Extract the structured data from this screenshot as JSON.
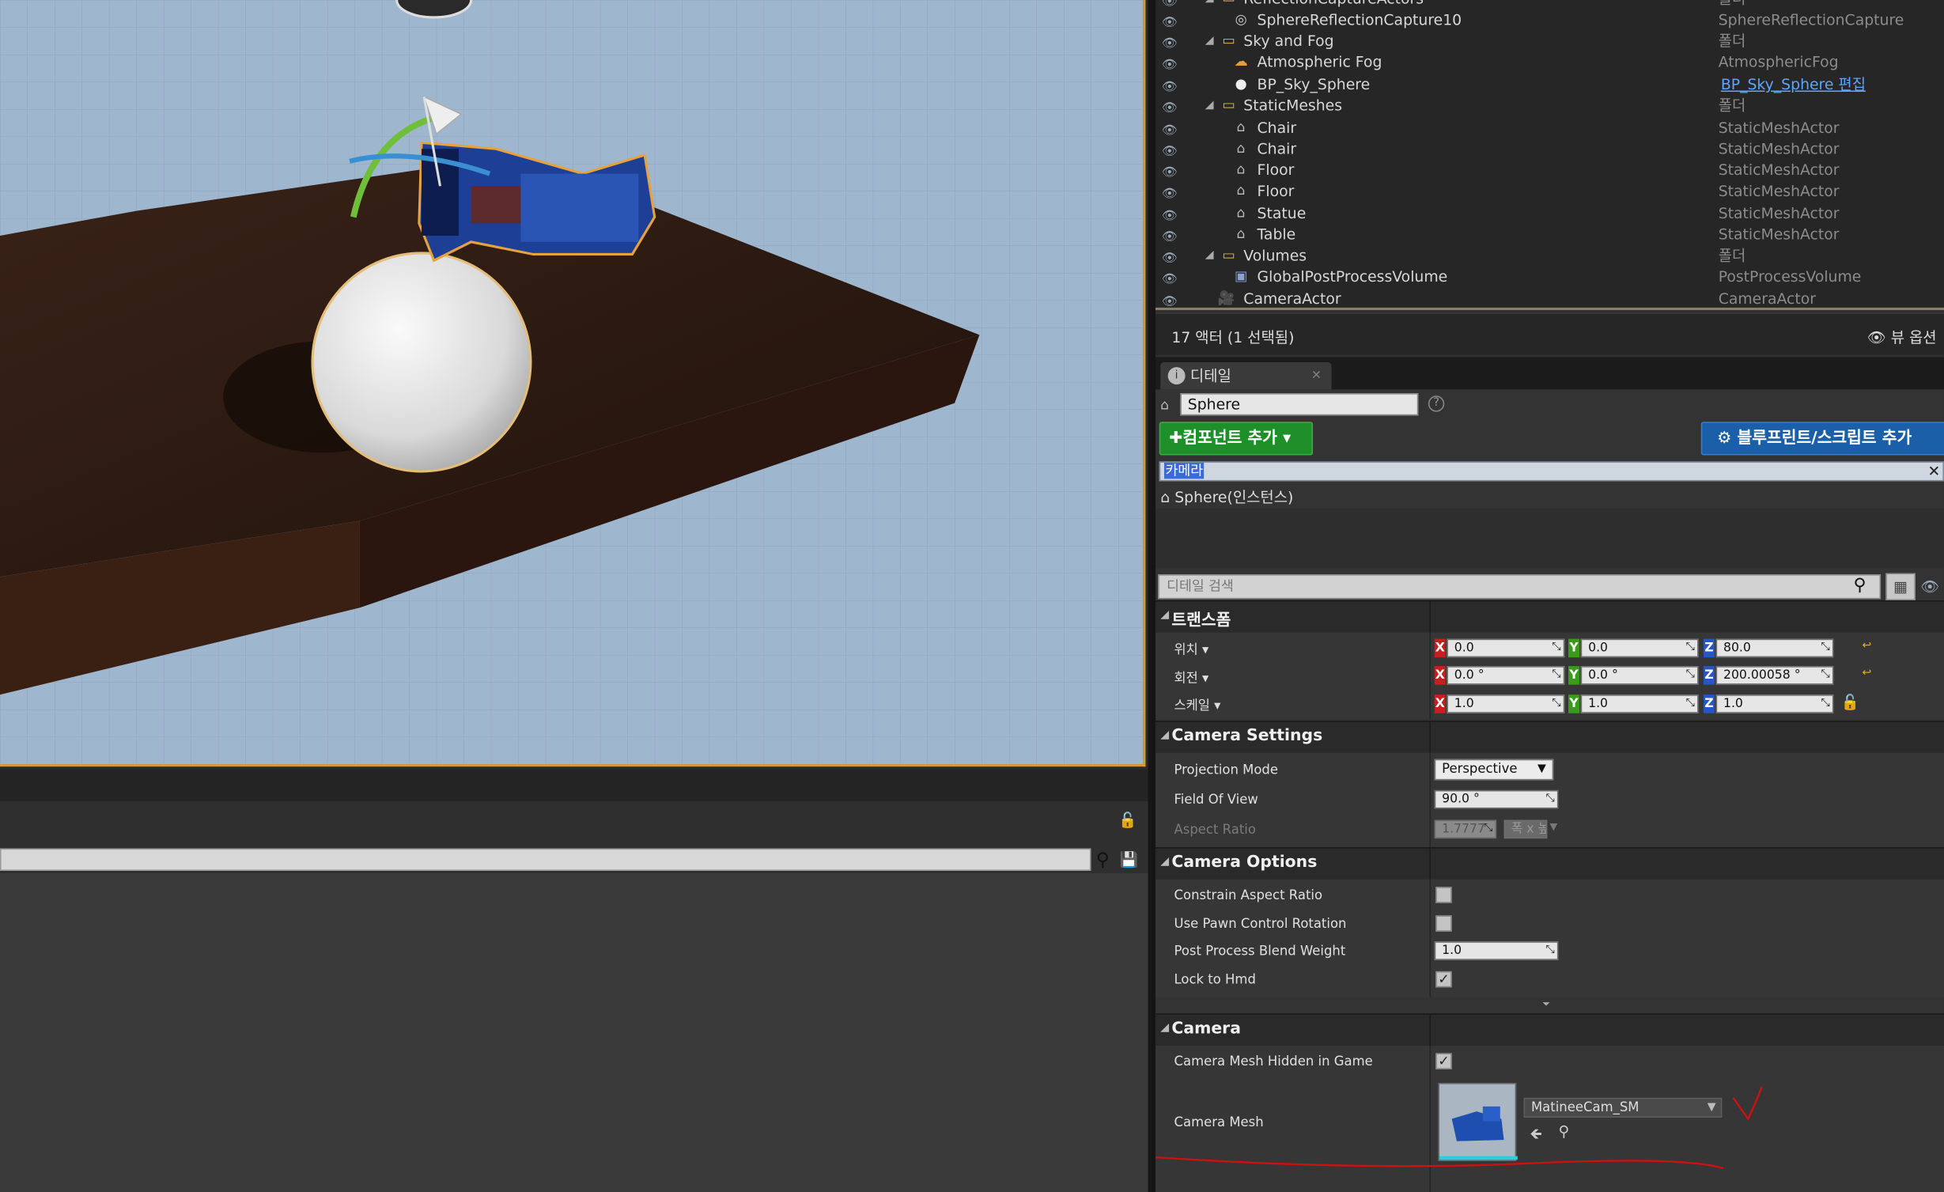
{
  "outliner": {
    "rows": [
      {
        "name": "ReflectionCaptureActors",
        "type": "폴더",
        "icon": "folder-icon"
      },
      {
        "name": "SphereReflectionCapture10",
        "type": "SphereReflectionCapture",
        "icon": "reflection-capture-icon"
      },
      {
        "name": "Sky and Fog",
        "type": "폴더",
        "icon": "folder-icon"
      },
      {
        "name": "Atmospheric Fog",
        "type": "AtmosphericFog",
        "icon": "fog-icon"
      },
      {
        "name": "BP_Sky_Sphere",
        "type": "BP_Sky_Sphere 편집",
        "icon": "sphere-icon"
      },
      {
        "name": "StaticMeshes",
        "type": "폴더",
        "icon": "folder-icon"
      },
      {
        "name": "Chair",
        "type": "StaticMeshActor",
        "icon": "static-mesh-icon"
      },
      {
        "name": "Chair",
        "type": "StaticMeshActor",
        "icon": "static-mesh-icon"
      },
      {
        "name": "Floor",
        "type": "StaticMeshActor",
        "icon": "static-mesh-icon"
      },
      {
        "name": "Floor",
        "type": "StaticMeshActor",
        "icon": "static-mesh-icon"
      },
      {
        "name": "Statue",
        "type": "StaticMeshActor",
        "icon": "static-mesh-icon"
      },
      {
        "name": "Table",
        "type": "StaticMeshActor",
        "icon": "static-mesh-icon"
      },
      {
        "name": "Volumes",
        "type": "폴더",
        "icon": "folder-icon"
      },
      {
        "name": "GlobalPostProcessVolume",
        "type": "PostProcessVolume",
        "icon": "volume-icon"
      },
      {
        "name": "CameraActor",
        "type": "CameraActor",
        "icon": "camera-icon"
      }
    ],
    "status": "17 액터 (1 선택됨)",
    "view_options": "뷰 옵션"
  },
  "details": {
    "tab_label": "디테일",
    "name_value": "Sphere",
    "add_component": "컴포넌트 추가",
    "blueprint_button": "블루프린트/스크립트 추가",
    "component_selected": "카메라",
    "component_instance": "Sphere(인스턴스)",
    "search_placeholder": "디테일 검색"
  },
  "transform": {
    "title": "트랜스폼",
    "location_label": "위치",
    "rotation_label": "회전",
    "scale_label": "스케일",
    "location": {
      "x": "0.0",
      "y": "0.0",
      "z": "80.0"
    },
    "rotation": {
      "x": "0.0 °",
      "y": "0.0 °",
      "z": "200.00058 °"
    },
    "scale": {
      "x": "1.0",
      "y": "1.0",
      "z": "1.0"
    }
  },
  "camera_settings": {
    "title": "Camera Settings",
    "projection_label": "Projection Mode",
    "projection_value": "Perspective",
    "fov_label": "Field Of View",
    "fov_value": "90.0 °",
    "aspect_label": "Aspect Ratio",
    "aspect_value": "1.7777",
    "aspect_preset": "폭 x 높"
  },
  "camera_options": {
    "title": "Camera Options",
    "constrain_label": "Constrain Aspect Ratio",
    "constrain_checked": false,
    "pawn_label": "Use Pawn Control Rotation",
    "pawn_checked": false,
    "blend_label": "Post Process Blend Weight",
    "blend_value": "1.0",
    "hmd_label": "Lock to Hmd",
    "hmd_checked": true
  },
  "camera": {
    "title": "Camera",
    "hidden_label": "Camera Mesh Hidden in Game",
    "hidden_checked": true,
    "mesh_label": "Camera Mesh",
    "mesh_value": "MatineeCam_SM"
  },
  "colors": {
    "selection_outline": "#d29a3a",
    "add_component_green": "#1f8f2a",
    "blueprint_blue": "#1a5fa8",
    "axis_x": "#c51f1f",
    "axis_y": "#3a9a1a",
    "axis_z": "#2456c5",
    "annotation_red": "#d01010"
  }
}
